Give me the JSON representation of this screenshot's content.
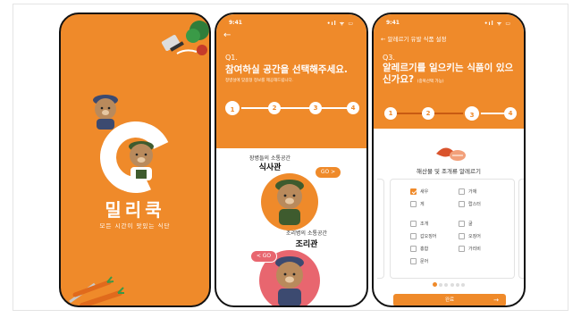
{
  "colors": {
    "brand_orange": "#ef8a2a",
    "dark_orange": "#c85a12",
    "checkbox_checked": "#ef8a2a"
  },
  "splash": {
    "logo_text": "밀리쿡",
    "tagline": "모든 시간이 맛있는 식단"
  },
  "space_screen": {
    "status": {
      "time": "9:41",
      "icons": "•ıl ᯤ ▭"
    },
    "back_icon": "arrow-left-icon",
    "question_no": "Q1.",
    "question_title": "참여하실 공간을 선택해주세요.",
    "question_hint": "정병설에 맞춤형 정보를 제공해드립니다.",
    "steps": [
      "1",
      "2",
      "3",
      "4"
    ],
    "active_step": 1,
    "option1": {
      "subtitle": "장병들의 소통공간",
      "title": "식사관",
      "button": "GO >"
    },
    "option2": {
      "subtitle": "조리병의 소통공간",
      "title": "조리관",
      "button": "< GO"
    }
  },
  "allergy_screen": {
    "status": {
      "time": "9:41",
      "icons": "•ıl ᯤ ▭"
    },
    "nav_title": "← 알레르기 유발 식품 설정",
    "question_no": "Q3.",
    "question_title": "알레르기를 일으키는 식품이 있으신가요?",
    "multi_note": "(중복선택 가능)",
    "steps": [
      "1",
      "2",
      "3",
      "4"
    ],
    "active_step": 3,
    "section_title": "해산물 및 조개류 알레르기",
    "options": [
      {
        "label": "새우",
        "checked": true
      },
      {
        "label": "게",
        "checked": false
      },
      {
        "label": "가재",
        "checked": false
      },
      {
        "label": "랍스터",
        "checked": false
      },
      {
        "label": "조개",
        "checked": false
      },
      {
        "label": "굴",
        "checked": false
      },
      {
        "label": "갑오징어",
        "checked": false
      },
      {
        "label": "오징어",
        "checked": false
      },
      {
        "label": "홍합",
        "checked": false
      },
      {
        "label": "가리비",
        "checked": false
      },
      {
        "label": "문어",
        "checked": false
      }
    ],
    "page_dots": 6,
    "active_dot": 1,
    "done_button": "완료",
    "done_arrow": "→"
  }
}
